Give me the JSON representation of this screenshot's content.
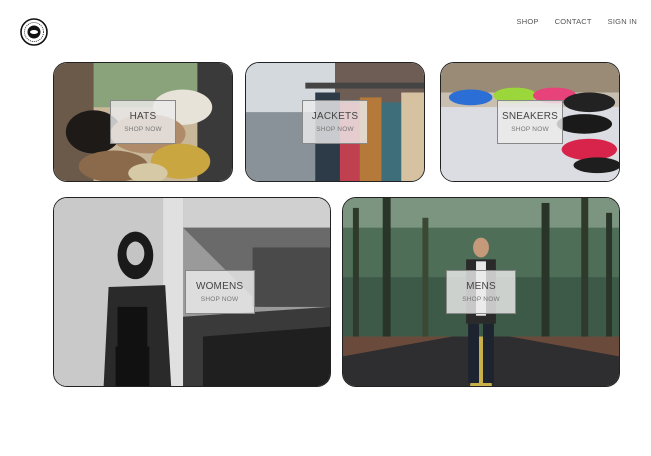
{
  "header": {
    "logo_icon": "brand-logo-icon",
    "nav": [
      {
        "label": "SHOP"
      },
      {
        "label": "CONTACT"
      },
      {
        "label": "SIGN IN"
      }
    ]
  },
  "categories": [
    {
      "title": "HATS",
      "cta": "SHOP NOW",
      "image": "hats-photo"
    },
    {
      "title": "JACKETS",
      "cta": "SHOP NOW",
      "image": "jackets-photo"
    },
    {
      "title": "SNEAKERS",
      "cta": "SHOP NOW",
      "image": "sneakers-photo"
    },
    {
      "title": "WOMENS",
      "cta": "SHOP NOW",
      "image": "womens-photo"
    },
    {
      "title": "MENS",
      "cta": "SHOP NOW",
      "image": "mens-photo"
    }
  ],
  "colors": {
    "background": "#ffffff",
    "border": "#222222",
    "label_bg": "#ebebeb",
    "nav_text": "#555555"
  }
}
